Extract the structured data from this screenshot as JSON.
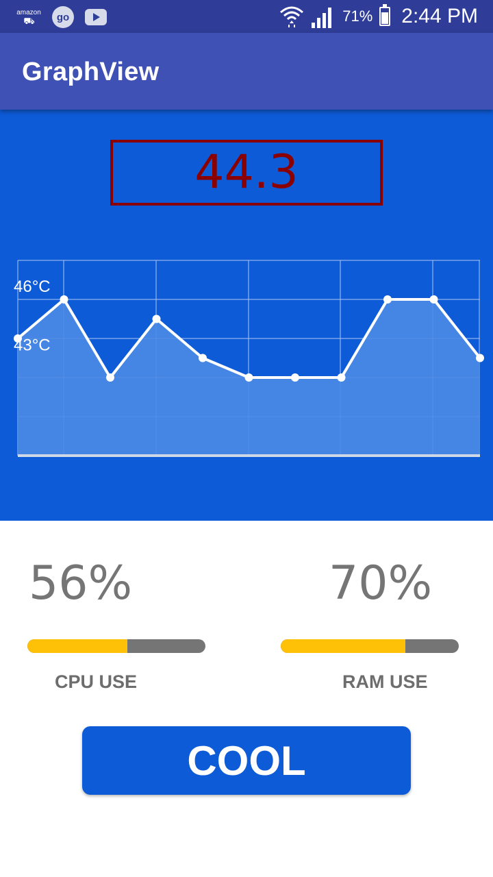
{
  "status_bar": {
    "left_icons": [
      "amazon-shopping-icon",
      "go-icon",
      "youtube-icon"
    ],
    "amazon_label": "amazon",
    "go_label": "go",
    "battery_percent": "71%",
    "time": "2:44 PM",
    "right_icons": [
      "wifi-icon",
      "signal-icon",
      "battery-charging-icon"
    ]
  },
  "app_bar": {
    "title": "GraphView"
  },
  "graph_panel": {
    "current_value": "44.3",
    "box_color": "#8b0000",
    "background_color": "#0e5bd8"
  },
  "chart_data": {
    "type": "area",
    "x": [
      0,
      1,
      2,
      3,
      4,
      5,
      6,
      7,
      8,
      9,
      10
    ],
    "values": [
      44,
      46,
      42,
      45,
      43,
      42,
      42,
      42,
      46,
      46,
      43
    ],
    "y_tick_labels": [
      "46°C",
      "43°C"
    ],
    "ylim": [
      38,
      48
    ],
    "xlim": [
      0,
      10
    ],
    "grid": true,
    "line_color": "#ffffff",
    "fill_color": "#4a8ae6"
  },
  "stats": {
    "cpu": {
      "value_text": "56%",
      "fraction": 0.56,
      "label": "CPU USE"
    },
    "ram": {
      "value_text": "70%",
      "fraction": 0.7,
      "label": "RAM USE"
    }
  },
  "colors": {
    "accent": "#0e5bd8",
    "app_bar": "#3f51b5",
    "progress_fill": "#ffc107",
    "progress_track": "#757575"
  },
  "actions": {
    "cool_label": "COOL"
  }
}
